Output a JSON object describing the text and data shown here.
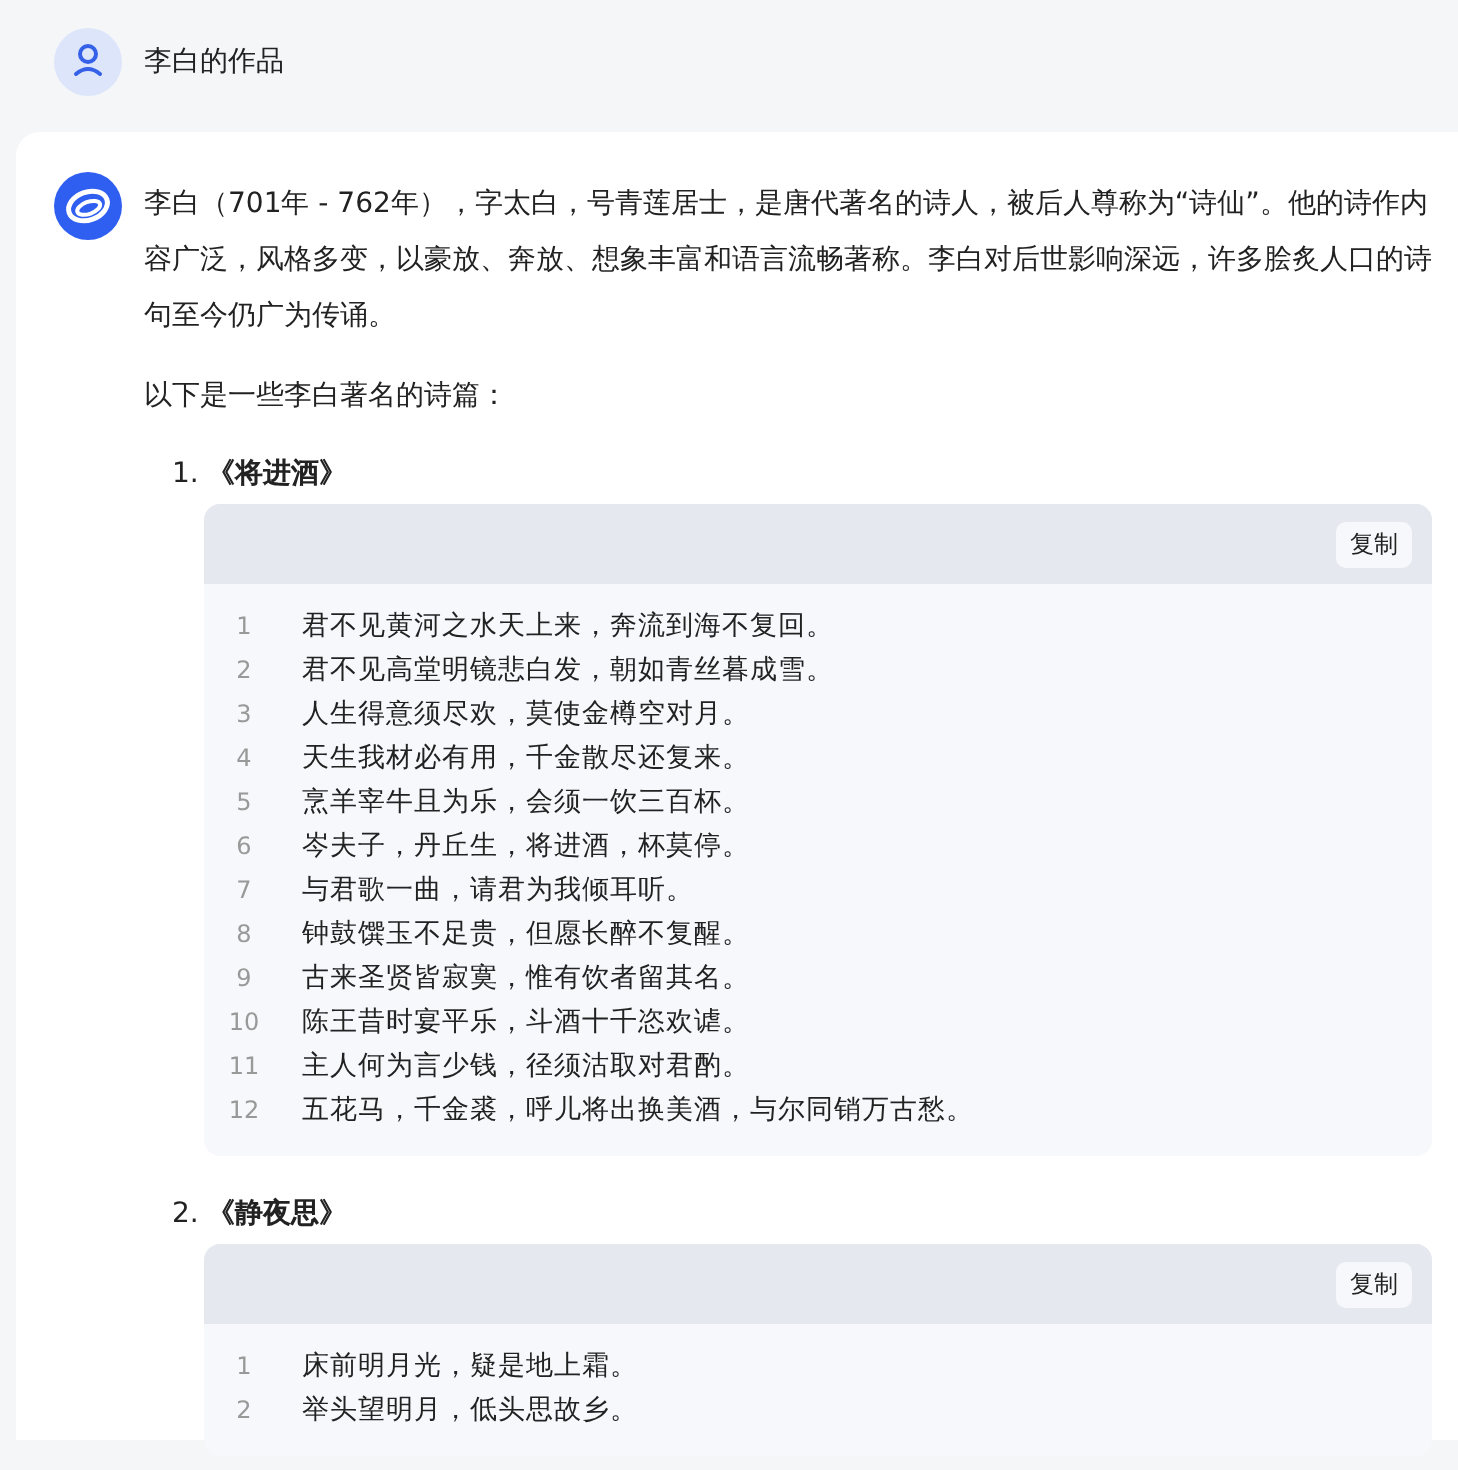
{
  "user": {
    "message": "李白的作品"
  },
  "answer": {
    "paragraph": "李白（701年 - 762年），字太白，号青莲居士，是唐代著名的诗人，被后人尊称为“诗仙”。他的诗作内容广泛，风格多变，以豪放、奔放、想象丰富和语言流畅著称。李白对后世影响深远，许多脍炙人口的诗句至今仍广为传诵。",
    "intro": "以下是一些李白著名的诗篇：",
    "poems": [
      {
        "number": "1.",
        "title": "《将进酒》",
        "copy_label": "复制",
        "lines": [
          {
            "no": "1",
            "text": "君不见黄河之水天上来，奔流到海不复回。"
          },
          {
            "no": "2",
            "text": "君不见高堂明镜悲白发，朝如青丝暮成雪。"
          },
          {
            "no": "3",
            "text": "人生得意须尽欢，莫使金樽空对月。"
          },
          {
            "no": "4",
            "text": "天生我材必有用，千金散尽还复来。"
          },
          {
            "no": "5",
            "text": "烹羊宰牛且为乐，会须一饮三百杯。"
          },
          {
            "no": "6",
            "text": "岑夫子，丹丘生，将进酒，杯莫停。"
          },
          {
            "no": "7",
            "text": "与君歌一曲，请君为我倾耳听。"
          },
          {
            "no": "8",
            "text": "钟鼓馔玉不足贵，但愿长醉不复醒。"
          },
          {
            "no": "9",
            "text": "古来圣贤皆寂寞，惟有饮者留其名。"
          },
          {
            "no": "10",
            "text": "陈王昔时宴平乐，斗酒十千恣欢谑。"
          },
          {
            "no": "11",
            "text": "主人何为言少钱，径须沽取对君酌。"
          },
          {
            "no": "12",
            "text": "五花马，千金裘，呼儿将出换美酒，与尔同销万古愁。"
          }
        ]
      },
      {
        "number": "2.",
        "title": "《静夜思》",
        "copy_label": "复制",
        "lines": [
          {
            "no": "1",
            "text": "床前明月光，疑是地上霜。"
          },
          {
            "no": "2",
            "text": "举头望明月，低头思故乡。"
          }
        ]
      }
    ]
  }
}
